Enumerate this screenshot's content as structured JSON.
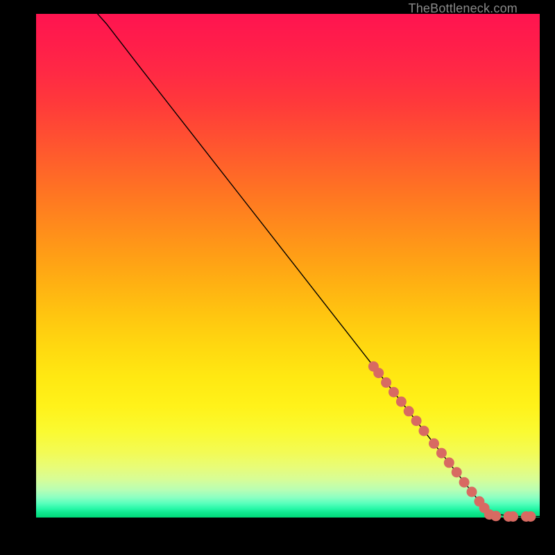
{
  "watermark": "TheBottleneck.com",
  "colors": {
    "background": "#000000",
    "curve": "#000000",
    "marker": "#d86a62",
    "watermark": "#8a8a8a"
  },
  "chart_data": {
    "type": "line",
    "title": "",
    "xlabel": "",
    "ylabel": "",
    "xlim": [
      0,
      100
    ],
    "ylim": [
      0,
      100
    ],
    "grid": false,
    "legend": false,
    "comment": "No axes, ticks, or numeric labels are rendered; values are estimated in percent of plot width/height with origin at bottom-left.",
    "series": [
      {
        "name": "curve",
        "type": "line",
        "x": [
          0,
          2,
          4,
          6,
          8,
          10,
          14,
          20,
          30,
          40,
          50,
          60,
          70,
          80,
          88,
          90,
          92,
          94,
          96,
          98,
          100
        ],
        "y": [
          109,
          108,
          107,
          106,
          104.5,
          102.5,
          98,
          90.2,
          77.4,
          64.6,
          51.8,
          39,
          26.2,
          13.4,
          3.2,
          1.4,
          0.6,
          0.3,
          0.2,
          0.2,
          0.2
        ]
      },
      {
        "name": "markers",
        "type": "scatter",
        "x": [
          67,
          68,
          69.5,
          71,
          72.5,
          74,
          75.5,
          77,
          79,
          80.5,
          82,
          83.5,
          85,
          86.5,
          88,
          89,
          90,
          91.3,
          93.8,
          94.7,
          97.3,
          98.2
        ],
        "y": [
          30.0,
          28.7,
          26.8,
          24.9,
          23.0,
          21.1,
          19.2,
          17.2,
          14.7,
          12.8,
          10.9,
          9.0,
          7.0,
          5.1,
          3.2,
          1.9,
          0.6,
          0.3,
          0.2,
          0.2,
          0.2,
          0.2
        ]
      }
    ]
  }
}
